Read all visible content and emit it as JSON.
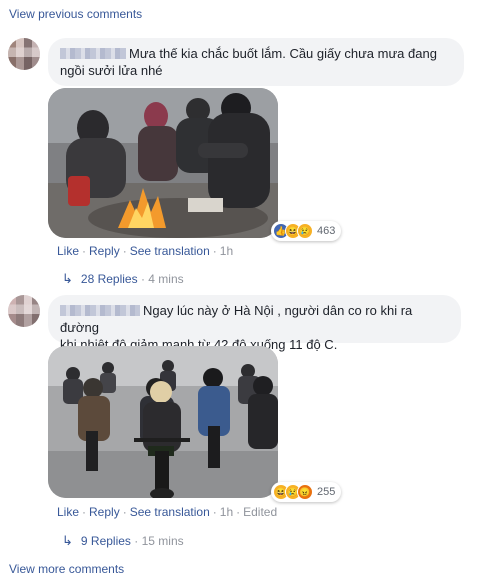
{
  "nav": {
    "view_previous": "View previous comments",
    "view_more": "View more comments"
  },
  "comments": [
    {
      "text_line1": "Mưa thế kia chắc buốt lắm. Cầu giấy chưa mưa đang",
      "text_line2": "ngồi sưởi lửa nhé",
      "actions": {
        "like": "Like",
        "reply": "Reply",
        "translate": "See translation",
        "time": "1h"
      },
      "reaction_count": "463",
      "replies": {
        "label": "28 Replies",
        "time": "4 mins"
      }
    },
    {
      "text_line1": "Ngay lúc này ở Hà Nội , người dân co ro khi ra đường",
      "text_line2": "khi nhiệt độ giảm mạnh từ 42 độ xuống 11 độ C.",
      "actions": {
        "like": "Like",
        "reply": "Reply",
        "translate": "See translation",
        "time": "1h",
        "edited": "Edited"
      },
      "reaction_count": "255",
      "replies": {
        "label": "9 Replies",
        "time": "15 mins"
      }
    }
  ],
  "colors": {
    "link": "#385898",
    "bubble": "#f2f3f5",
    "muted": "#90949c"
  },
  "icons": [
    "like-reaction-icon",
    "haha-reaction-icon",
    "sad-reaction-icon",
    "angry-reaction-icon",
    "reply-arrow-icon"
  ]
}
